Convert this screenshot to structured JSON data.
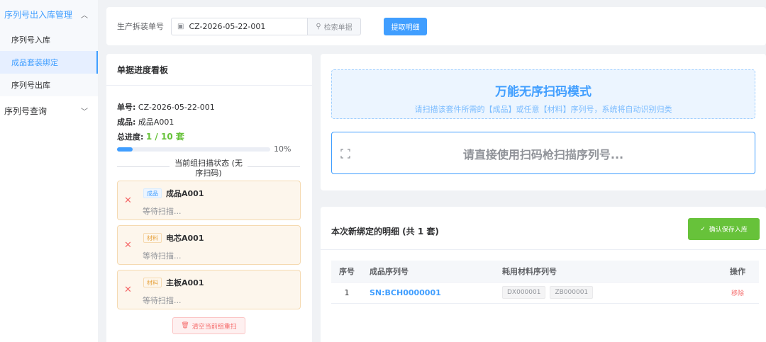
{
  "sidebar": {
    "group_inout": "序列号出入库管理",
    "items": [
      {
        "label": "序列号入库"
      },
      {
        "label": "成品套装绑定"
      },
      {
        "label": "序列号出库"
      }
    ],
    "group_query": "序列号查询"
  },
  "topbar": {
    "order_label": "生产拆装单号",
    "order_value": "CZ-2026-05-22-001",
    "search_label": "检索单据",
    "fetch_label": "提取明细"
  },
  "board": {
    "title": "单据进度看板",
    "order_key": "单号:",
    "order_val": "CZ-2026-05-22-001",
    "product_key": "成品:",
    "product_val": "成品A001",
    "progress_key": "总进度:",
    "progress_val": "1 / 10 套",
    "progress_fraction": 0.1,
    "progress_pct": "10%",
    "group_status_line1": "当前组扫描状态 (无",
    "group_status_line2": "序扫码)",
    "cards": [
      {
        "tag": "成品",
        "tag_color": "blue",
        "name": "成品A001",
        "status": "等待扫描..."
      },
      {
        "tag": "材料",
        "tag_color": "orange",
        "name": "电芯A001",
        "status": "等待扫描..."
      },
      {
        "tag": "材料",
        "tag_color": "orange",
        "name": "主板A001",
        "status": "等待扫描..."
      }
    ],
    "clear_label": "清空当前组重扫"
  },
  "scan": {
    "mode_title": "万能无序扫码模式",
    "mode_desc": "请扫描该套件所需的【成品】或任意【材料】序列号，系统将自动识别归类",
    "placeholder": "请直接使用扫码枪扫描序列号..."
  },
  "detail": {
    "title": "本次新绑定的明细 (共 1 套)",
    "save_label": "确认保存入库",
    "columns": {
      "no": "序号",
      "sn": "成品序列号",
      "materials": "耗用材料序列号",
      "ops": "操作"
    },
    "rows": [
      {
        "no": "1",
        "sn": "SN:BCH0000001",
        "mat1": "DX000001",
        "mat2": "ZB000001",
        "action": "移除"
      }
    ]
  },
  "colors": {
    "primary": "#409eff",
    "success": "#67c23a",
    "danger": "#f56c6c",
    "warning": "#e6a23c"
  }
}
